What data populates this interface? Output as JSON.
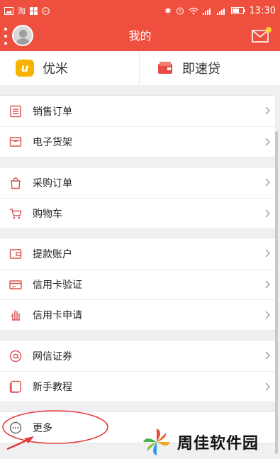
{
  "statusbar": {
    "left_icons": [
      "image-icon",
      "taobao-icon",
      "app-icon",
      "chat-icon"
    ],
    "time": "13:30"
  },
  "header": {
    "title": "我的"
  },
  "tiles": [
    {
      "label": "优米",
      "icon": "youmi-logo-icon"
    },
    {
      "label": "即速贷",
      "icon": "card-icon"
    }
  ],
  "menu": {
    "group1": [
      {
        "label": "销售订单",
        "icon": "sales-order-icon"
      },
      {
        "label": "电子货架",
        "icon": "shelf-icon"
      }
    ],
    "group2": [
      {
        "label": "采购订单",
        "icon": "purchase-bag-icon"
      },
      {
        "label": "购物车",
        "icon": "cart-icon"
      }
    ],
    "group3": [
      {
        "label": "提款账户",
        "icon": "wallet-icon"
      },
      {
        "label": "信用卡验证",
        "icon": "credit-card-icon"
      },
      {
        "label": "信用卡申请",
        "icon": "hand-icon"
      }
    ],
    "group4": [
      {
        "label": "网信证券",
        "icon": "at-icon"
      },
      {
        "label": "新手教程",
        "icon": "tutorial-icon"
      }
    ],
    "group5": [
      {
        "label": "更多",
        "icon": "more-icon"
      }
    ]
  },
  "watermark": {
    "text": "周佳软件园"
  },
  "colors": {
    "brand": "#ef4f3f",
    "icon": "#d9534f",
    "badge": "#ffd12a"
  }
}
